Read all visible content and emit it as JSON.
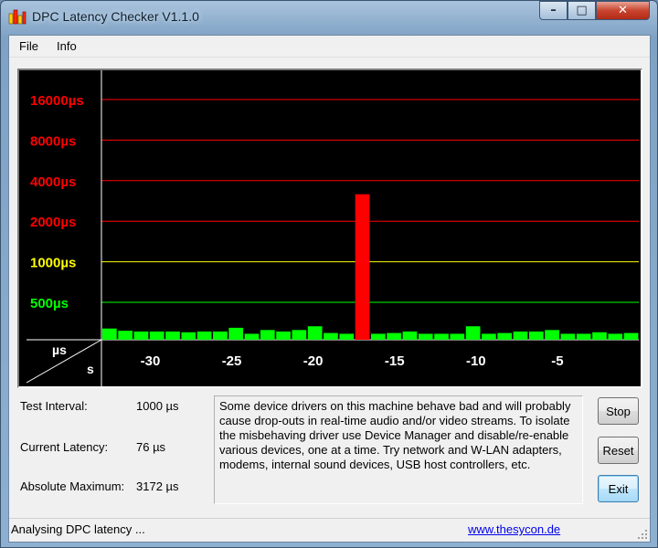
{
  "window": {
    "title": "DPC Latency Checker V1.1.0",
    "controls": {
      "minimize": "–",
      "maximize": "□",
      "close": "✕"
    }
  },
  "menu": {
    "file": "File",
    "info": "Info"
  },
  "colors": {
    "bar_normal": "#00ff00",
    "bar_high": "#ff0000",
    "grid_red": "#ff0000",
    "grid_yellow": "#ffff00",
    "grid_green": "#00ff00",
    "panel_bg": "#000000"
  },
  "chart_data": {
    "type": "bar",
    "y_scale": "log",
    "y_levels": [
      {
        "label": "16000µs",
        "value": 16000,
        "color": "#ff0000"
      },
      {
        "label": "8000µs",
        "value": 8000,
        "color": "#ff0000"
      },
      {
        "label": "4000µs",
        "value": 4000,
        "color": "#ff0000"
      },
      {
        "label": "2000µs",
        "value": 2000,
        "color": "#ff0000"
      },
      {
        "label": "1000µs",
        "value": 1000,
        "color": "#ffff00"
      },
      {
        "label": "500µs",
        "value": 500,
        "color": "#00ff00"
      }
    ],
    "x_range": [
      -33,
      0
    ],
    "x_ticks": [
      {
        "label": "-30",
        "value": -30
      },
      {
        "label": "-25",
        "value": -25
      },
      {
        "label": "-20",
        "value": -20
      },
      {
        "label": "-15",
        "value": -15
      },
      {
        "label": "-10",
        "value": -10
      },
      {
        "label": "-5",
        "value": -5
      }
    ],
    "corner_unit_y": "µs",
    "corner_unit_x": "s",
    "values": [
      150,
      120,
      110,
      110,
      110,
      100,
      110,
      110,
      160,
      80,
      130,
      110,
      130,
      180,
      90,
      80,
      3172,
      80,
      90,
      110,
      80,
      80,
      80,
      180,
      80,
      90,
      110,
      110,
      130,
      80,
      80,
      100,
      80,
      90
    ]
  },
  "info": {
    "test_interval_label": "Test Interval:",
    "test_interval_value": "1000 µs",
    "current_latency_label": "Current Latency:",
    "current_latency_value": "76 µs",
    "absolute_max_label": "Absolute Maximum:",
    "absolute_max_value": "3172 µs"
  },
  "message": {
    "line1": "Some device drivers on this machine behave bad and will probably",
    "line2": "cause drop-outs in real-time audio and/or video streams. To isolate",
    "line3": "the misbehaving driver use Device Manager and disable/re-enable",
    "line4": "various devices, one at a time. Try network and W-LAN adapters,",
    "line5": "modems, internal sound devices, USB host controllers, etc."
  },
  "buttons": {
    "stop": "Stop",
    "reset": "Reset",
    "exit": "Exit"
  },
  "status": {
    "text": "Analysing DPC latency ...",
    "link": "www.thesycon.de"
  }
}
